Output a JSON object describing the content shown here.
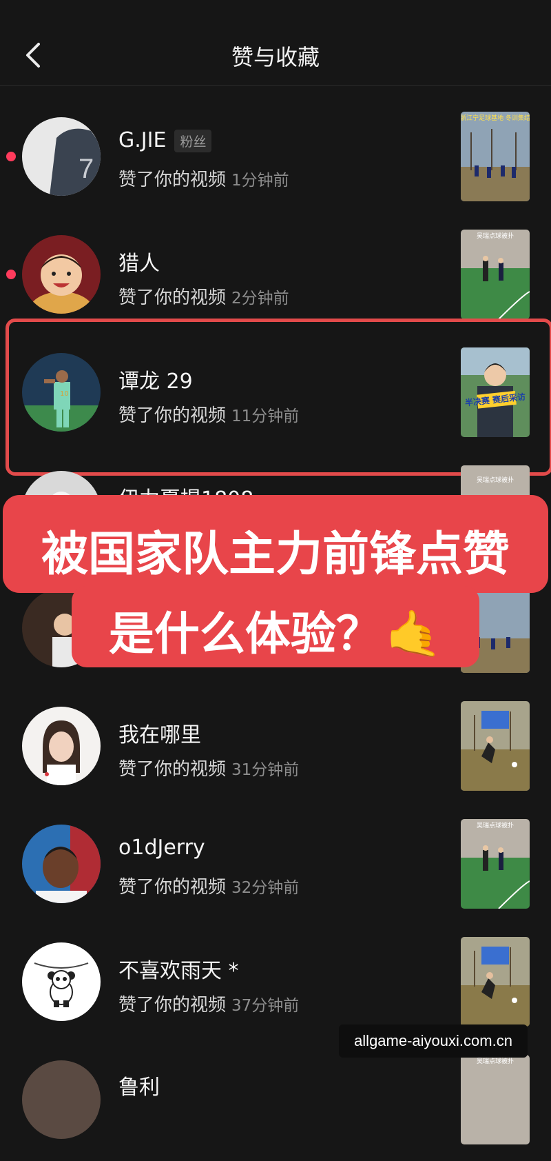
{
  "header": {
    "title": "赞与收藏"
  },
  "rows": [
    {
      "name": "G.JIE",
      "badge": "粉丝",
      "action": "赞了你的视频",
      "time": "1分钟前",
      "unread": true,
      "thumb_text": "浙江宁足球基地 冬训集结"
    },
    {
      "name": "猎人",
      "action": "赞了你的视频",
      "time": "2分钟前",
      "unread": true,
      "thumb_text": "吴瑞点球被扑"
    },
    {
      "name": "谭龙 29",
      "action": "赞了你的视频",
      "time": "11分钟前",
      "thumb_text": "半决赛 赛后采访"
    },
    {
      "name": "伊力夏提1808",
      "thumb_text": "吴瑞点球被扑"
    },
    {
      "name": "",
      "thumb_text": ""
    },
    {
      "name": "我在哪里",
      "action": "赞了你的视频",
      "time": "31分钟前"
    },
    {
      "name": "o1dJerry",
      "action": "赞了你的视频",
      "time": "32分钟前",
      "thumb_text": "吴瑞点球被扑"
    },
    {
      "name": "不喜欢雨天 *",
      "action": "赞了你的视频",
      "time": "37分钟前"
    },
    {
      "name": "鲁利",
      "thumb_text": "吴瑞点球被扑"
    }
  ],
  "banner": {
    "line1": "被国家队主力前锋点赞",
    "line2": "是什么体验？",
    "emoji": "🤙"
  },
  "watermark": "allgame-aiyouxi.com.cn",
  "colors": {
    "background": "#161616",
    "unread_dot": "#ff3b5c",
    "highlight": "#e34b4b",
    "banner": "#e8454a"
  }
}
